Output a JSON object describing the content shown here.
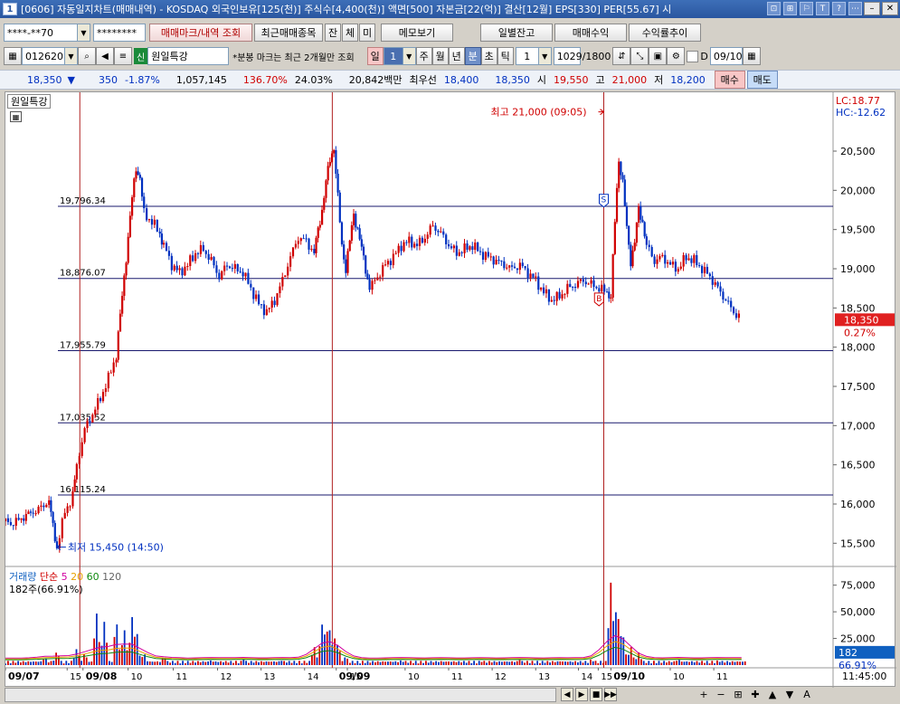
{
  "window": {
    "number": "1",
    "title": "[0606] 자동일지차트(매매내역) - KOSDAQ 외국인보유[125(천)] 주식수[4,400(천)] 액면[500] 자본금[22(억)] 결산[12월] EPS[330] PER[55.67] 시"
  },
  "toolbar1": {
    "account_masked": "****-**70",
    "password_masked": "********",
    "trade_mark_btn": "매매마크/내역 조회",
    "recent_trades_btn": "최근매매종목",
    "tab_jan": "잔",
    "tab_che": "체",
    "tab_mi": "미",
    "memo_btn": "메모보기",
    "daily_balance_btn": "일별잔고",
    "trade_profit_btn": "매매수익",
    "return_trend_btn": "수익률추이"
  },
  "toolbar2": {
    "code": "012620",
    "badge": "신",
    "stock_name": "원일특강",
    "notice": "*분봉 마크는 최근 2개월만 조회",
    "period_label": "일",
    "period_count": "1",
    "tab_week": "주",
    "tab_month": "월",
    "tab_year": "년",
    "tab_minute": "분",
    "tab_second": "초",
    "tab_tick": "틱",
    "interval": "1",
    "bars_count": "1029",
    "bars_total": "/1800",
    "date_value": "09/10"
  },
  "quote": {
    "price": "18,350",
    "change": "350",
    "change_pct": "-1.87%",
    "volume": "1,057,145",
    "vol_ratio": "136.70%",
    "turnover": "24.03%",
    "amount": "20,842백만",
    "best_ask_label": "최우선",
    "best_ask": "18,400",
    "best_bid": "18,350",
    "open_label": "시",
    "open": "19,550",
    "high_label": "고",
    "high": "21,000",
    "low_label": "저",
    "low": "18,200",
    "buy_btn": "매수",
    "sell_btn": "매도"
  },
  "colors": {
    "up": "#d00000",
    "down": "#0030c0",
    "hline": "#1a1a6e",
    "vline": "#b02020",
    "price_box": "#e02020",
    "vol_box": "#1060c0"
  },
  "chart_data": {
    "type": "candlestick",
    "stock_label": "원일특강",
    "top_right": {
      "lc": "LC:18.77",
      "hc": "HC:-12.62"
    },
    "y_ticks": [
      "20,500",
      "20,000",
      "19,500",
      "19,000",
      "18,500",
      "18,000",
      "17,500",
      "17,000",
      "16,500",
      "16,000",
      "15,500"
    ],
    "y_range": [
      15250,
      21250
    ],
    "hlines": [
      {
        "value": 19796.34,
        "label": "19,796.34"
      },
      {
        "value": 18876.07,
        "label": "18,876.07"
      },
      {
        "value": 17955.79,
        "label": "17,955.79"
      },
      {
        "value": 17035.52,
        "label": "17,035.52"
      },
      {
        "value": 16115.24,
        "label": "16,115.24"
      }
    ],
    "annotations": {
      "high": {
        "text": "최고 21,000 (09:05)",
        "value": 21000
      },
      "low": {
        "text": "최저 15,450 (14:50)",
        "value": 15450
      }
    },
    "markers": [
      {
        "text": "S",
        "value": 19880
      },
      {
        "text": "B",
        "value": 18620
      }
    ],
    "current_price": {
      "value": 18350,
      "label": "18,350",
      "pct": "0.27%"
    },
    "x_labels": [
      "09/07",
      "15",
      "09/08",
      "10",
      "11",
      "12",
      "13",
      "14",
      "15",
      "09/09",
      "10",
      "11",
      "12",
      "13",
      "14",
      "15",
      "09/10",
      "10",
      "11"
    ],
    "time_now": "11:45:00",
    "volume": {
      "legend_name": "거래량",
      "legend_ma": "단순",
      "ma_periods": [
        "5",
        "20",
        "60",
        "120"
      ],
      "sub_label": "182주(66.91%)",
      "y_ticks": [
        "75,000",
        "50,000",
        "25,000"
      ],
      "y_range": [
        0,
        90000
      ],
      "current": "182",
      "current_pct": "66.91%"
    },
    "price_path": [
      [
        0.0,
        15780
      ],
      [
        0.01,
        15750
      ],
      [
        0.02,
        15820
      ],
      [
        0.035,
        15900
      ],
      [
        0.045,
        15950
      ],
      [
        0.055,
        16050
      ],
      [
        0.06,
        15700
      ],
      [
        0.065,
        15450
      ],
      [
        0.075,
        15900
      ],
      [
        0.085,
        16100
      ],
      [
        0.09,
        16500
      ],
      [
        0.1,
        16950
      ],
      [
        0.11,
        17150
      ],
      [
        0.12,
        17350
      ],
      [
        0.13,
        17600
      ],
      [
        0.14,
        17900
      ],
      [
        0.145,
        18400
      ],
      [
        0.15,
        18900
      ],
      [
        0.155,
        19400
      ],
      [
        0.16,
        19900
      ],
      [
        0.165,
        20300
      ],
      [
        0.17,
        20150
      ],
      [
        0.175,
        19700
      ],
      [
        0.185,
        19600
      ],
      [
        0.195,
        19450
      ],
      [
        0.2,
        19300
      ],
      [
        0.21,
        19050
      ],
      [
        0.22,
        18950
      ],
      [
        0.23,
        19050
      ],
      [
        0.24,
        19200
      ],
      [
        0.25,
        19250
      ],
      [
        0.26,
        19100
      ],
      [
        0.27,
        18900
      ],
      [
        0.28,
        19050
      ],
      [
        0.29,
        19000
      ],
      [
        0.3,
        18950
      ],
      [
        0.31,
        18750
      ],
      [
        0.32,
        18550
      ],
      [
        0.33,
        18450
      ],
      [
        0.34,
        18600
      ],
      [
        0.35,
        18850
      ],
      [
        0.36,
        19150
      ],
      [
        0.37,
        19400
      ],
      [
        0.38,
        19350
      ],
      [
        0.39,
        19200
      ],
      [
        0.395,
        19500
      ],
      [
        0.4,
        19750
      ],
      [
        0.405,
        20100
      ],
      [
        0.41,
        20400
      ],
      [
        0.415,
        20550
      ],
      [
        0.42,
        19900
      ],
      [
        0.425,
        19300
      ],
      [
        0.43,
        19000
      ],
      [
        0.435,
        19350
      ],
      [
        0.44,
        19700
      ],
      [
        0.445,
        19500
      ],
      [
        0.45,
        19250
      ],
      [
        0.455,
        19000
      ],
      [
        0.46,
        18750
      ],
      [
        0.47,
        18900
      ],
      [
        0.48,
        19050
      ],
      [
        0.49,
        19150
      ],
      [
        0.5,
        19300
      ],
      [
        0.51,
        19350
      ],
      [
        0.52,
        19300
      ],
      [
        0.53,
        19400
      ],
      [
        0.54,
        19550
      ],
      [
        0.55,
        19450
      ],
      [
        0.56,
        19300
      ],
      [
        0.57,
        19200
      ],
      [
        0.58,
        19250
      ],
      [
        0.59,
        19300
      ],
      [
        0.6,
        19200
      ],
      [
        0.61,
        19150
      ],
      [
        0.62,
        19100
      ],
      [
        0.63,
        19050
      ],
      [
        0.64,
        19000
      ],
      [
        0.65,
        19050
      ],
      [
        0.66,
        18950
      ],
      [
        0.67,
        18850
      ],
      [
        0.68,
        18700
      ],
      [
        0.69,
        18600
      ],
      [
        0.7,
        18650
      ],
      [
        0.71,
        18750
      ],
      [
        0.72,
        18800
      ],
      [
        0.73,
        18850
      ],
      [
        0.74,
        18800
      ],
      [
        0.75,
        18750
      ],
      [
        0.76,
        18700
      ],
      [
        0.765,
        18650
      ],
      [
        0.77,
        19600
      ],
      [
        0.775,
        20400
      ],
      [
        0.78,
        20100
      ],
      [
        0.785,
        19500
      ],
      [
        0.79,
        19100
      ],
      [
        0.795,
        19350
      ],
      [
        0.8,
        19750
      ],
      [
        0.805,
        19600
      ],
      [
        0.81,
        19300
      ],
      [
        0.82,
        19100
      ],
      [
        0.83,
        19150
      ],
      [
        0.84,
        19050
      ],
      [
        0.85,
        19000
      ],
      [
        0.86,
        19150
      ],
      [
        0.87,
        19100
      ],
      [
        0.88,
        19000
      ],
      [
        0.89,
        18900
      ],
      [
        0.9,
        18750
      ],
      [
        0.91,
        18600
      ],
      [
        0.92,
        18450
      ],
      [
        0.93,
        18350
      ]
    ],
    "volume_spikes": [
      [
        0.05,
        8000
      ],
      [
        0.065,
        14000
      ],
      [
        0.09,
        16000
      ],
      [
        0.1,
        12000
      ],
      [
        0.115,
        50000
      ],
      [
        0.125,
        42000
      ],
      [
        0.14,
        44000
      ],
      [
        0.15,
        35000
      ],
      [
        0.16,
        45000
      ],
      [
        0.165,
        38000
      ],
      [
        0.175,
        12000
      ],
      [
        0.2,
        9000
      ],
      [
        0.26,
        5000
      ],
      [
        0.3,
        6000
      ],
      [
        0.35,
        5000
      ],
      [
        0.39,
        18000
      ],
      [
        0.4,
        38000
      ],
      [
        0.405,
        41000
      ],
      [
        0.41,
        35000
      ],
      [
        0.415,
        30000
      ],
      [
        0.42,
        22000
      ],
      [
        0.43,
        9000
      ],
      [
        0.5,
        5000
      ],
      [
        0.55,
        4000
      ],
      [
        0.6,
        4000
      ],
      [
        0.65,
        5000
      ],
      [
        0.7,
        4000
      ],
      [
        0.74,
        6000
      ],
      [
        0.765,
        80000
      ],
      [
        0.77,
        62000
      ],
      [
        0.775,
        48000
      ],
      [
        0.78,
        30000
      ],
      [
        0.79,
        18000
      ],
      [
        0.8,
        12000
      ],
      [
        0.85,
        6000
      ],
      [
        0.9,
        5000
      ],
      [
        0.93,
        3000
      ]
    ]
  }
}
